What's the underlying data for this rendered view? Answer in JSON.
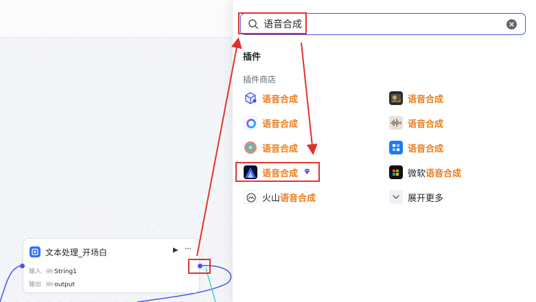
{
  "canvas": {
    "node": {
      "title": "文本处理_开场白",
      "run_icon": "▶",
      "more_icon": "···",
      "input_label": "输入",
      "input_type": "str",
      "input_value": "String1",
      "output_label": "输出",
      "output_type": "str",
      "output_value": "output"
    }
  },
  "search": {
    "value": "语音合成",
    "section_title": "插件",
    "subsection_title": "插件商店"
  },
  "plugins": {
    "left": [
      {
        "prefix": "",
        "highlight": "语音合成",
        "icon": "cube-logo"
      },
      {
        "prefix": "",
        "highlight": "语音合成",
        "icon": "gradient-ring-logo"
      },
      {
        "prefix": "",
        "highlight": "语音合成",
        "icon": "teal-circle-logo"
      },
      {
        "prefix": "",
        "highlight": "语音合成",
        "icon": "mountain-logo",
        "badge": "premium-gem-icon"
      },
      {
        "prefix": "火山",
        "highlight": "语音合成",
        "icon": "volcano-logo"
      }
    ],
    "right": [
      {
        "prefix": "",
        "highlight": "语音合成",
        "icon": "photo-logo"
      },
      {
        "prefix": "",
        "highlight": "语音合成",
        "icon": "waveform-logo"
      },
      {
        "prefix": "",
        "highlight": "语音合成",
        "icon": "blue-tile-logo"
      },
      {
        "prefix": "微软",
        "highlight": "语音合成",
        "icon": "microsoft-logo"
      }
    ],
    "more_label": "展开更多"
  },
  "colors": {
    "accent": "#4d53e8",
    "highlight_text": "#ea7d1c",
    "annotation_red": "#e0322b"
  }
}
